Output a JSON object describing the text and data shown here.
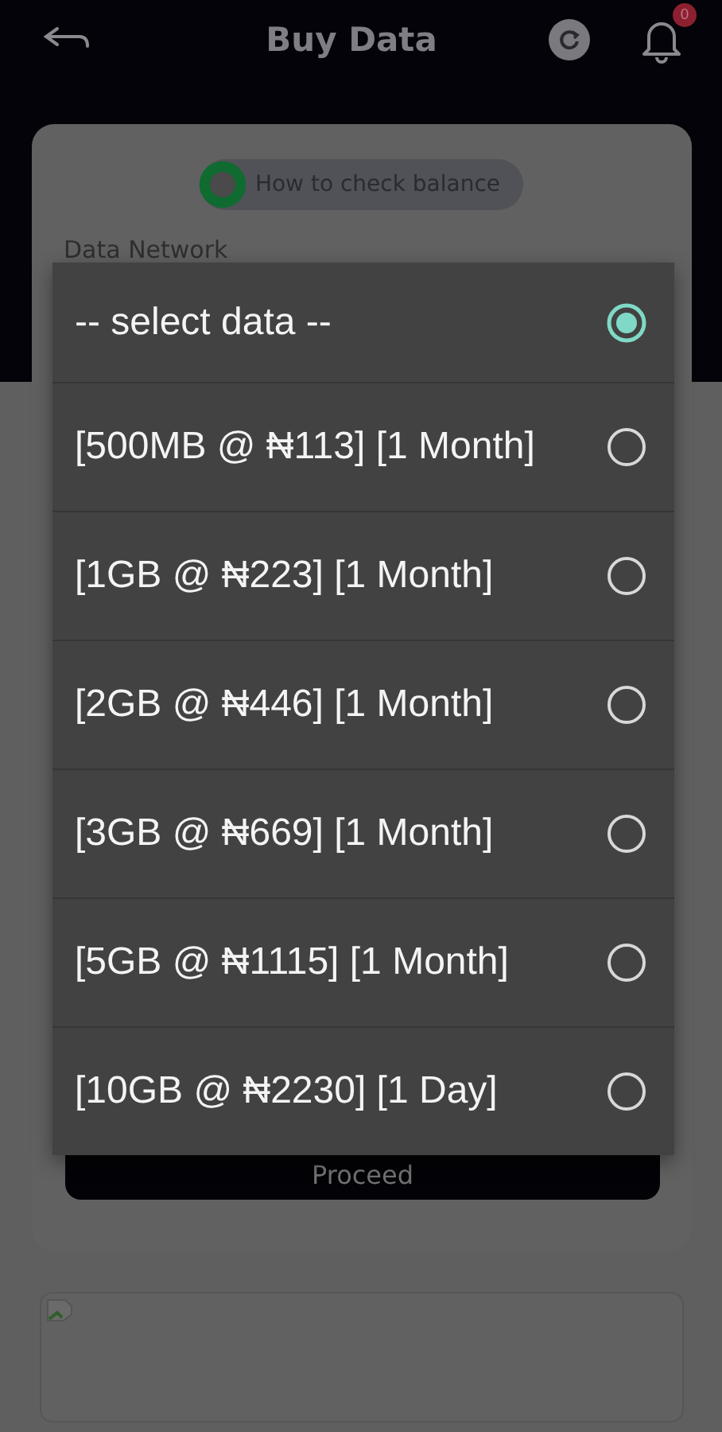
{
  "header": {
    "title": "Buy Data",
    "notification_count": "0"
  },
  "help_link": {
    "label": "How to check balance"
  },
  "form": {
    "network_label": "Data Network",
    "submit_button": "Proceed"
  },
  "dialog": {
    "options": [
      {
        "label": "-- select data --",
        "selected": true
      },
      {
        "label": "[500MB @ ₦113] [1 Month]",
        "selected": false
      },
      {
        "label": "[1GB @ ₦223] [1 Month]",
        "selected": false
      },
      {
        "label": "[2GB @ ₦446] [1 Month]",
        "selected": false
      },
      {
        "label": "[3GB @ ₦669] [1 Month]",
        "selected": false
      },
      {
        "label": "[5GB @ ₦1115] [1 Month]",
        "selected": false
      },
      {
        "label": "[10GB @ ₦2230] [1 Day]",
        "selected": false
      }
    ]
  }
}
